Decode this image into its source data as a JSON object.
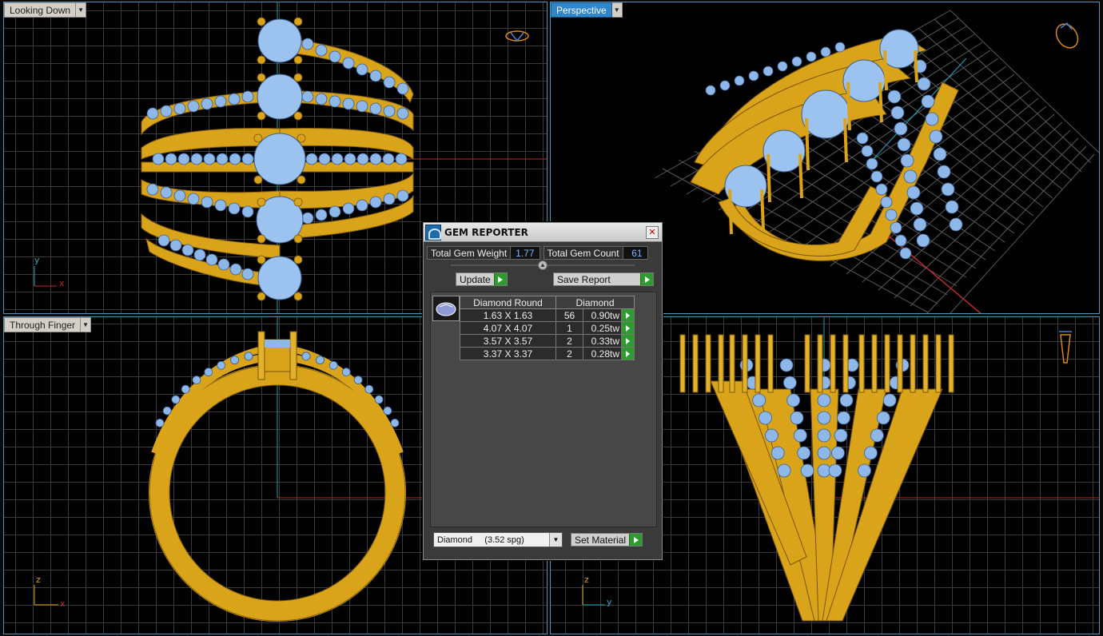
{
  "viewports": {
    "top_left": {
      "label": "Looking Down",
      "axis_v": "y",
      "axis_h": "x"
    },
    "top_right": {
      "label": "Perspective"
    },
    "bottom_left": {
      "label": "Through Finger",
      "axis_v": "z",
      "axis_h": "x"
    },
    "bottom_right": {
      "axis_v": "z",
      "axis_h": "y"
    }
  },
  "dialog": {
    "title": "GEM REPORTER",
    "close_icon": "close-icon",
    "total_weight_label": "Total Gem Weight",
    "total_weight_value": "1.77",
    "total_count_label": "Total Gem Count",
    "total_count_value": "61",
    "update_label": "Update",
    "save_report_label": "Save Report",
    "table": {
      "col_shape": "Diamond Round",
      "col_material": "Diamond",
      "rows": [
        {
          "size": "1.63 X 1.63",
          "count": "56",
          "weight": "0.90tw"
        },
        {
          "size": "4.07 X 4.07",
          "count": "1",
          "weight": "0.25tw"
        },
        {
          "size": "3.57 X 3.57",
          "count": "2",
          "weight": "0.33tw"
        },
        {
          "size": "3.37 X 3.37",
          "count": "2",
          "weight": "0.28tw"
        }
      ]
    },
    "material_select": "Diamond     (3.52 spg)",
    "set_material_label": "Set Material"
  },
  "colors": {
    "gold": "#d9a31a",
    "gem": "#8fb8ea",
    "axis_red": "#c0282a",
    "axis_cyan": "#1a9fb0",
    "active_tab": "#2f86c8"
  }
}
